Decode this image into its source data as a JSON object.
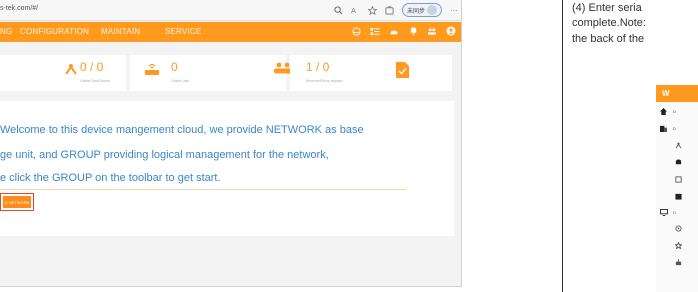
{
  "browser": {
    "url": "s-tek.com/#/",
    "profile_label": "未同步"
  },
  "nav": {
    "items": [
      "NG",
      "CONFIGURATION",
      "MAINTAIN",
      "SERVICE"
    ]
  },
  "stats": [
    {
      "value": "0 / 0",
      "label": "Online/Total Device"
    },
    {
      "value": "0",
      "label": "Online User"
    },
    {
      "value": "1 / 0",
      "label": "Received/Send request"
    }
  ],
  "welcome": {
    "lines": [
      "Welcome to this device mangement cloud, we provide NETWORK as base",
      "ge unit, and GROUP providing logical management for the network,",
      "e click the GROUP on the toolbar to get start."
    ],
    "button_label": "D NETWORK"
  },
  "manual": {
    "lines": [
      "(4)  Enter seria",
      "complete.Note:",
      "the back of the"
    ],
    "thumb_title": "W",
    "thumb_rows": [
      "D",
      "D",
      "",
      "",
      "",
      "",
      "D",
      "",
      "",
      ""
    ]
  },
  "colors": {
    "accent": "#ff9a1f",
    "welcome_text": "#3a86c7",
    "button_border": "#e34a2a"
  },
  "icons": [
    "search-icon",
    "star-icon",
    "favorites-icon",
    "collections-icon",
    "more-icon",
    "chart-icon",
    "layout-icon",
    "cloud-icon",
    "bell-icon",
    "people-icon",
    "user-icon",
    "network-icon",
    "router-icon",
    "users-group-icon",
    "document-check-icon"
  ]
}
